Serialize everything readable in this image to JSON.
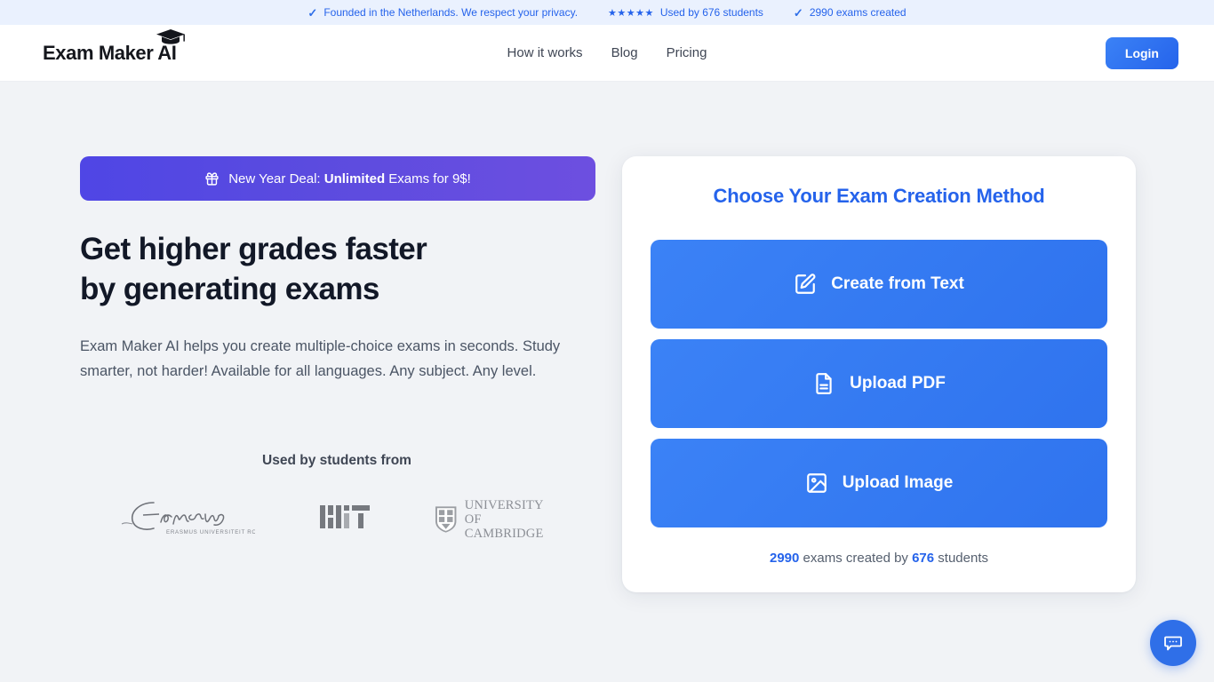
{
  "topbar": {
    "items": [
      {
        "icon": "check-icon",
        "text": "Founded in the Netherlands. We respect your privacy."
      },
      {
        "icon": "stars-icon",
        "stars": "★★★★★",
        "text": "Used by 676 students"
      },
      {
        "icon": "check-icon",
        "text": "2990 exams created"
      }
    ]
  },
  "header": {
    "logo_text": "Exam Maker AI",
    "logo_icon": "graduation-cap-icon",
    "nav": [
      {
        "label": "How it works"
      },
      {
        "label": "Blog"
      },
      {
        "label": "Pricing"
      }
    ],
    "login_label": "Login"
  },
  "hero": {
    "promo": {
      "icon": "gift-icon",
      "prefix": "New Year Deal: ",
      "highlight": "Unlimited",
      "suffix": " Exams for 9$!"
    },
    "headline_line1": "Get higher grades faster",
    "headline_line2": "by generating exams",
    "paragraph": "Exam Maker AI helps you create multiple-choice exams in seconds. Study smarter, not harder! Available for all languages. Any subject. Any level."
  },
  "social_proof": {
    "title": "Used by students from",
    "logos": [
      {
        "name": "erasmus-university-rotterdam-logo",
        "caption": "ERASMUS UNIVERSITEIT ROTTERDAM"
      },
      {
        "name": "mit-logo",
        "caption": "MIT"
      },
      {
        "name": "university-of-cambridge-logo",
        "line1": "UNIVERSITY OF",
        "line2": "CAMBRIDGE"
      }
    ]
  },
  "card": {
    "title": "Choose Your Exam Creation Method",
    "actions": [
      {
        "icon": "square-pen-icon",
        "label": "Create from Text"
      },
      {
        "icon": "file-text-icon",
        "label": "Upload PDF"
      },
      {
        "icon": "image-icon",
        "label": "Upload Image"
      }
    ],
    "stats": {
      "exams_count": "2990",
      "middle_text": " exams created by ",
      "students_count": "676",
      "suffix": " students"
    }
  },
  "chat_widget": {
    "icon": "chat-bubble-icon"
  },
  "colors": {
    "accent_blue": "#2563eb",
    "promo_purple": "#5b4bdf",
    "topbar_bg": "#eaf1fe",
    "page_bg": "#f1f3f6",
    "headline": "#121827"
  }
}
